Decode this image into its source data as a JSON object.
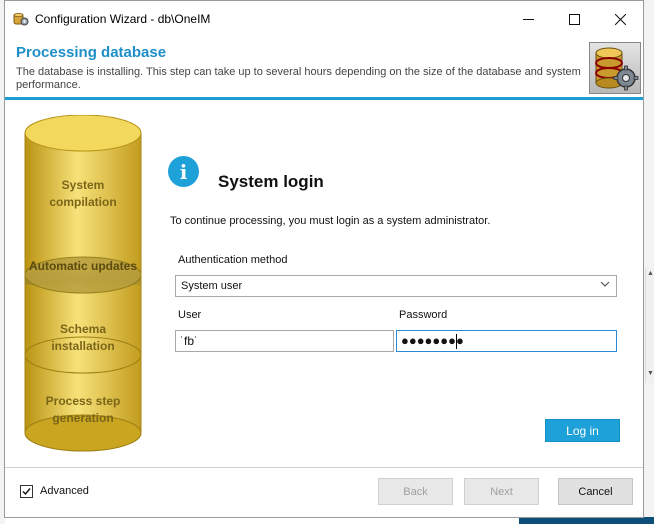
{
  "window": {
    "title": "Configuration Wizard - db\\OneIM"
  },
  "header": {
    "title": "Processing database",
    "description": "The database is installing. This step can take up to several hours depending on the size of the database and system performance."
  },
  "steps": [
    {
      "label_line1": "System",
      "label_line2": "compilation"
    },
    {
      "label_line1": "Automatic updates",
      "label_line2": ""
    },
    {
      "label_line1": "Schema",
      "label_line2": "installation"
    },
    {
      "label_line1": "Process step",
      "label_line2": "generation"
    }
  ],
  "content": {
    "info_glyph": "i",
    "title": "System login",
    "instruction": "To continue processing, you must login as a system administrator.",
    "auth_label": "Authentication method",
    "auth_value": "System user",
    "user_label": "User",
    "user_value": "˙fb˙",
    "password_label": "Password",
    "password_masked": "●●●●●●●●",
    "login_button": "Log in"
  },
  "footer": {
    "advanced_label": "Advanced",
    "advanced_checked": true,
    "back_label": "Back",
    "next_label": "Next",
    "cancel_label": "Cancel"
  },
  "colors": {
    "accent": "#1ea0d8",
    "header_title": "#1e8fc8",
    "cylinder": "#e2c33a"
  },
  "icons": {
    "app": "wizard-gear-icon",
    "header_logo": "database-gear-icon",
    "info": "info-icon",
    "chevron": "chevron-down-icon",
    "check": "checkmark-icon"
  }
}
